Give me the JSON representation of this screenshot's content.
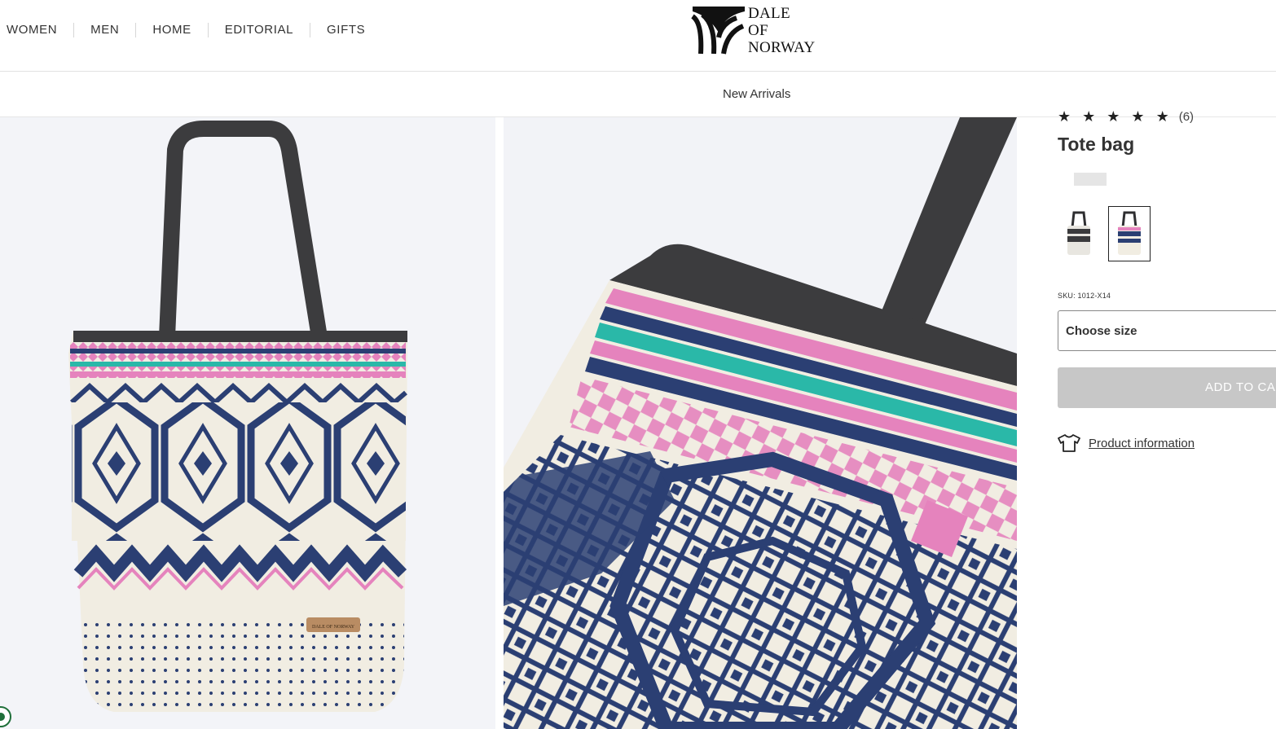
{
  "nav": {
    "items": [
      {
        "label": "WOMEN"
      },
      {
        "label": "MEN"
      },
      {
        "label": "HOME"
      },
      {
        "label": "EDITORIAL"
      },
      {
        "label": "GIFTS"
      }
    ]
  },
  "logo": {
    "line1": "DALE",
    "line2": "OF",
    "line3": "NORWAY",
    "icon": "dale-of-norway-logo-icon"
  },
  "subnav": {
    "link": "New Arrivals"
  },
  "gallery": {
    "images": [
      {
        "name": "tote-bag-front-image"
      },
      {
        "name": "tote-bag-closeup-image"
      }
    ],
    "label_on_bag": "DALE OF NORWAY"
  },
  "product": {
    "stars": [
      "★",
      "★",
      "★",
      "★",
      "★"
    ],
    "review_count": "(6)",
    "title": "Tote bag",
    "sku": "SKU: 1012-X14",
    "size_placeholder": "Choose size",
    "add_to_cart": "ADD TO CA",
    "product_info_link": "Product information",
    "product_info_icon": "tshirt-icon",
    "colors": {
      "accent_navy": "#2b3f73",
      "accent_pink": "#e583bd",
      "accent_teal": "#2ab8a8",
      "handle_gray": "#3c3c3e",
      "cream": "#f1ede2",
      "button_disabled": "#c7c7c7"
    }
  }
}
